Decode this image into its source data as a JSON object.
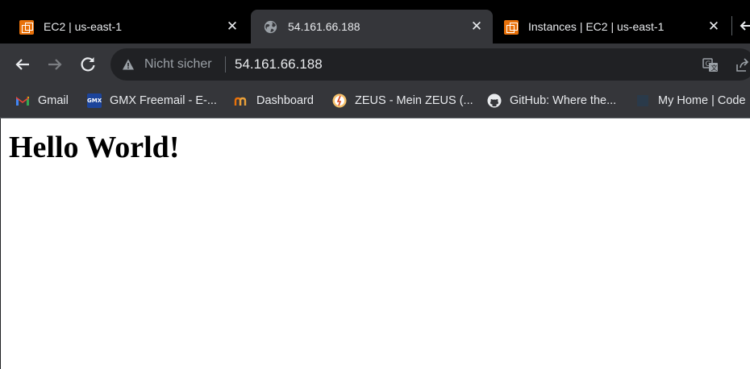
{
  "tabs": [
    {
      "title": "EC2 | us-east-1",
      "close": "✕",
      "favicon": "aws-ec2-icon"
    },
    {
      "title": "54.161.66.188",
      "close": "✕",
      "favicon": "globe-icon"
    },
    {
      "title": "Instances | EC2 | us-east-1",
      "close": "✕",
      "favicon": "aws-ec2-icon"
    }
  ],
  "toolbar": {
    "secure_label": "Nicht sicher",
    "url": "54.161.66.188"
  },
  "bookmarks": [
    {
      "label": "Gmail"
    },
    {
      "label": "GMX Freemail - E-..."
    },
    {
      "label": "Dashboard"
    },
    {
      "label": "ZEUS - Mein ZEUS (..."
    },
    {
      "label": "GitHub: Where the..."
    },
    {
      "label": "My Home | Code"
    }
  ],
  "page": {
    "heading": "Hello World!"
  },
  "colors": {
    "tabstrip": "#000000",
    "toolbar": "#35363a",
    "omnibox": "#202124",
    "text": "#e8eaed"
  }
}
